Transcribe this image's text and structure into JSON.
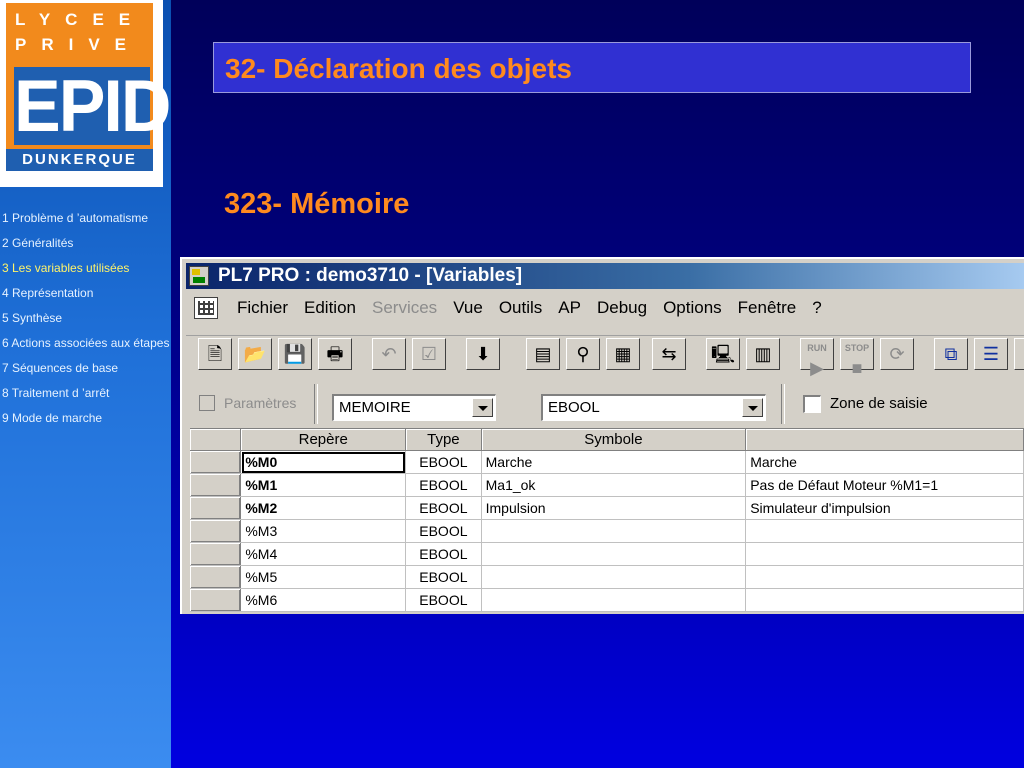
{
  "logo": {
    "line1": "LYCEE",
    "line2": "PRIVE",
    "brand": "EPID",
    "city": "DUNKERQUE"
  },
  "nav": [
    {
      "label": "1 Problème d ’automatisme",
      "active": false
    },
    {
      "label": "2 Généralités",
      "active": false
    },
    {
      "label": "3 Les variables utilisées",
      "active": true
    },
    {
      "label": "4 Représentation",
      "active": false
    },
    {
      "label": "5 Synthèse",
      "active": false
    },
    {
      "label": "6 Actions associées aux étapes",
      "active": false
    },
    {
      "label": "7 Séquences de base",
      "active": false
    },
    {
      "label": "8 Traitement d ’arrêt",
      "active": false
    },
    {
      "label": "9 Mode de marche",
      "active": false
    }
  ],
  "slide": {
    "title": "32- Déclaration des objets",
    "subtitle": "323- Mémoire"
  },
  "window": {
    "title": "PL7 PRO : demo3710 - [Variables]",
    "menu": [
      "Fichier",
      "Edition",
      "Services",
      "Vue",
      "Outils",
      "AP",
      "Debug",
      "Options",
      "Fenêtre",
      "?"
    ],
    "toolbar": {
      "run_label": "RUN",
      "stop_label": "STOP"
    },
    "params": {
      "checkbox_label": "Paramètres",
      "category_value": "MEMOIRE",
      "type_value": "EBOOL",
      "zone_label": "Zone de saisie"
    },
    "grid": {
      "headers": [
        "Repère",
        "Type",
        "Symbole",
        ""
      ],
      "rows": [
        {
          "repere": "%M0",
          "type": "EBOOL",
          "symbole": "Marche",
          "commentaire": "Marche"
        },
        {
          "repere": "%M1",
          "type": "EBOOL",
          "symbole": "Ma1_ok",
          "commentaire": "Pas de Défaut Moteur %M1=1"
        },
        {
          "repere": "%M2",
          "type": "EBOOL",
          "symbole": "Impulsion",
          "commentaire": "Simulateur d'impulsion"
        },
        {
          "repere": "%M3",
          "type": "EBOOL",
          "symbole": "",
          "commentaire": ""
        },
        {
          "repere": "%M4",
          "type": "EBOOL",
          "symbole": "",
          "commentaire": ""
        },
        {
          "repere": "%M5",
          "type": "EBOOL",
          "symbole": "",
          "commentaire": ""
        },
        {
          "repere": "%M6",
          "type": "EBOOL",
          "symbole": "",
          "commentaire": ""
        }
      ]
    }
  }
}
